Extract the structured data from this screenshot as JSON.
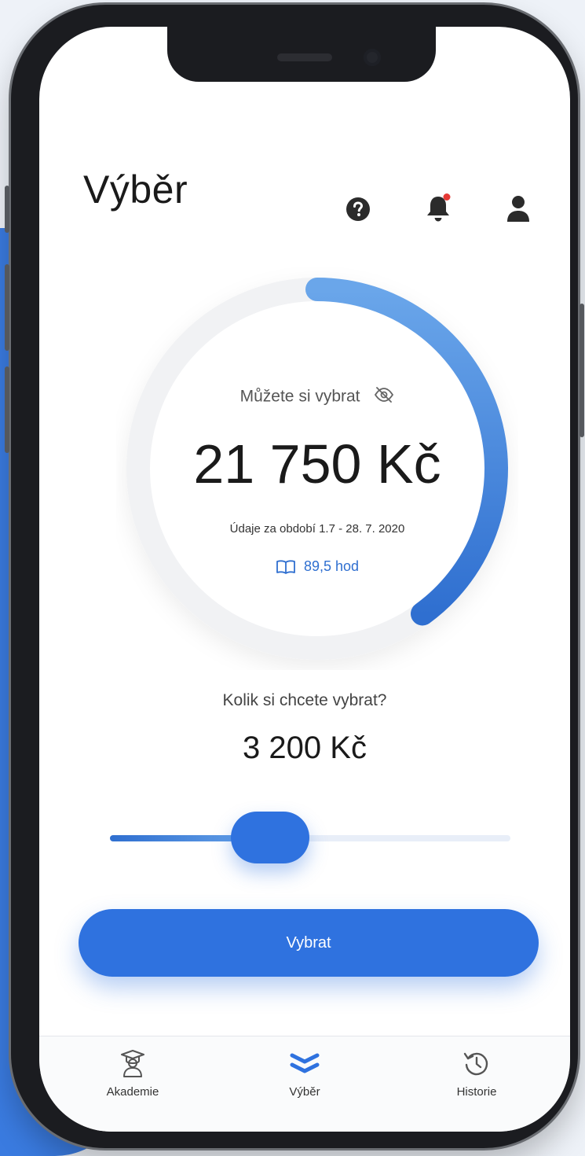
{
  "header": {
    "title": "Výběr",
    "icons": [
      "help-icon",
      "bell-icon",
      "user-icon"
    ],
    "notification_dot_color": "#e53935"
  },
  "balance": {
    "label": "Můžete si vybrat",
    "amount": "21 750 Kč",
    "period": "Údaje za období  1.7 - 28. 7. 2020",
    "hours": "89,5 hod",
    "progress": 0.4
  },
  "withdrawal": {
    "question": "Kolik si chcete vybrat?",
    "amount": "3 200 Kč",
    "slider_value": 0.4
  },
  "submit_label": "Vybrat",
  "tabs": [
    {
      "label": "Akademie",
      "icon": "graduation-cap-icon"
    },
    {
      "label": "Výběr",
      "icon": "double-chevron-icon",
      "active": true
    },
    {
      "label": "Historie",
      "icon": "history-icon"
    }
  ],
  "colors": {
    "accent": "#2f72df",
    "accent_light": "#6aa6ea",
    "background_shape": "#3a7be0"
  }
}
